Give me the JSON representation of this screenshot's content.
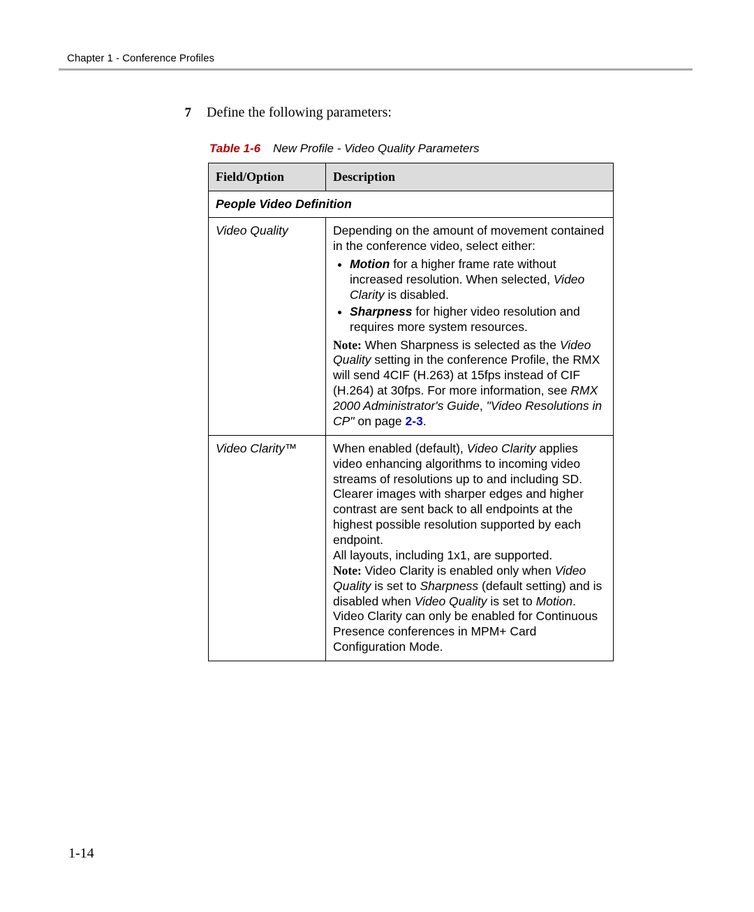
{
  "chapter_header": "Chapter 1 - Conference Profiles",
  "step": {
    "number": "7",
    "text": "Define the following parameters:"
  },
  "caption": {
    "label": "Table 1-6",
    "text": "New Profile - Video Quality Parameters"
  },
  "table": {
    "headers": {
      "field": "Field/Option",
      "description": "Description"
    },
    "section_header": "People Video Definition",
    "rows": {
      "video_quality": {
        "field": "Video Quality",
        "intro": "Depending on the amount of movement contained in the conference video, select either:",
        "bullet1_lead": "Motion",
        "bullet1_rest_a": " for a higher frame rate without increased resolution. When selected, ",
        "bullet1_vc": "Video Clarity",
        "bullet1_rest_b": " is disabled.",
        "bullet2_lead": "Sharpness",
        "bullet2_rest": " for higher video resolution and requires more system resources.",
        "note_label": "Note:",
        "note_a": " When Sharpness is selected as the ",
        "note_vq": "Video Quality",
        "note_b": " setting in the conference Profile, the RMX will send 4CIF (H.263) at 15fps instead of CIF (H.264) at 30fps. For more information, see ",
        "note_guide": "RMX 2000 Administrator's Guide",
        "note_c": ", ",
        "note_link_title": "\"Video Resolutions in CP\"",
        "note_d": " on page ",
        "note_pageref": "2-3",
        "note_e": "."
      },
      "video_clarity": {
        "field": "Video Clarity™",
        "p1_a": "When enabled (default), ",
        "p1_vc": "Video Clarity",
        "p1_b": " applies video enhancing algorithms to incoming video streams of resolutions up to and including SD. Clearer images with sharper edges and higher contrast are sent back to all endpoints at the highest possible resolution supported by each endpoint.",
        "p2": "All layouts, including 1x1, are supported.",
        "note_label": "Note:",
        "n_a": " Video Clarity is enabled only when ",
        "n_vq": "Video Quality",
        "n_b": " is set to ",
        "n_sharp": "Sharpness",
        "n_c": " (default setting) and is disabled when ",
        "n_vq2": "Video Quality",
        "n_d": " is set to ",
        "n_motion": "Motion",
        "n_e": ".",
        "p4": "Video Clarity can only be enabled for Continuous Presence conferences in MPM+ Card Configuration Mode."
      }
    }
  },
  "page_number": "1-14"
}
